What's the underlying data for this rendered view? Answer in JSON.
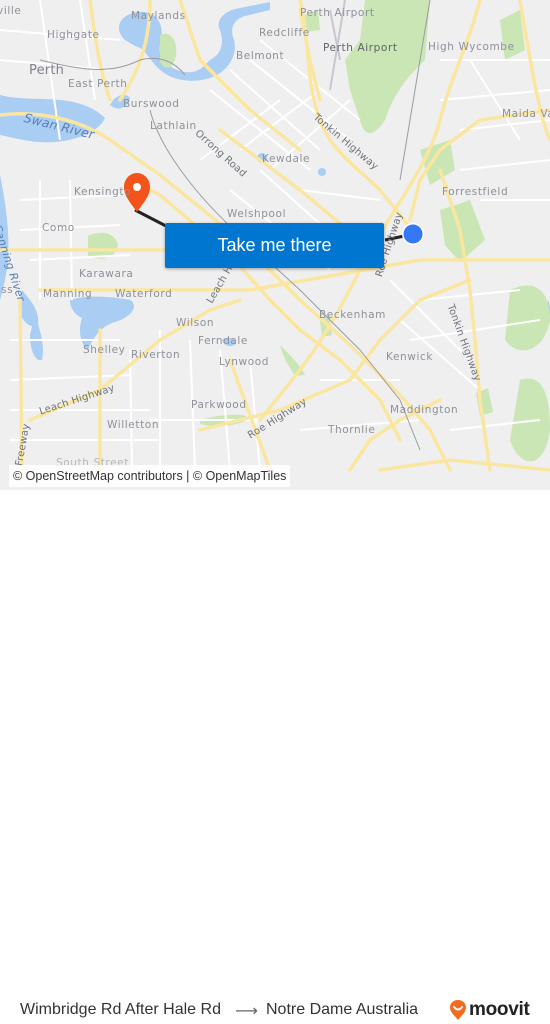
{
  "map": {
    "labels": {
      "perth": "Perth",
      "highgate": "Highgate",
      "east_perth": "East Perth",
      "maylands": "Maylands",
      "burswood": "Burswood",
      "lathlain": "Lathlain",
      "swan_river": "Swan River",
      "belmont": "Belmont",
      "redcliffe": "Redcliffe",
      "perth_airport_top": "Perth Airport",
      "perth_airport": "Perth Airport",
      "high_wycombe": "High Wycombe",
      "maida_vale": "Maida Va",
      "kewdale": "Kewdale",
      "forrestfield": "Forrestfield",
      "welshpool": "Welshpool",
      "kensington": "Kensingto",
      "como": "Como",
      "karawara": "Karawara",
      "manning": "Manning",
      "waterford": "Waterford",
      "canning_river": "Canning River",
      "wilson": "Wilson",
      "shelley": "Shelley",
      "riverton": "Riverton",
      "ferndale": "Ferndale",
      "lynwood": "Lynwood",
      "parkwood": "Parkwood",
      "willetton": "Willetton",
      "beckenham": "Beckenham",
      "kenwick": "Kenwick",
      "maddington": "Maddington",
      "thornlie": "Thornlie",
      "south_street": "South Street",
      "ville": "ville",
      "oss": "oss",
      "orrong_road": "Orrong Road",
      "tonkin_highway_n": "Tonkin Highway",
      "tonkin_highway_s": "Tonkin Highway",
      "leach_highway_w": "Leach Highway",
      "leach_highway_c": "Leach High",
      "roe_highway_w": "Roe Highway",
      "roe_highway_e": "Roe Highway",
      "freeway": "Freeway"
    },
    "origin_marker": {
      "type": "current-stop-dot",
      "color": "#3478f6"
    },
    "destination_marker": {
      "type": "map-pin",
      "color": "#f2541b"
    },
    "route_line_color": "#222222",
    "cta_label": "Take me there",
    "cta_color": "#0076d1",
    "attribution": "© OpenStreetMap contributors | © OpenMapTiles"
  },
  "footer": {
    "from": "Wimbridge Rd After Hale Rd",
    "arrow": "⟶",
    "to": "Notre Dame Australia",
    "brand": "moovit",
    "brand_color": "#f26b21"
  }
}
